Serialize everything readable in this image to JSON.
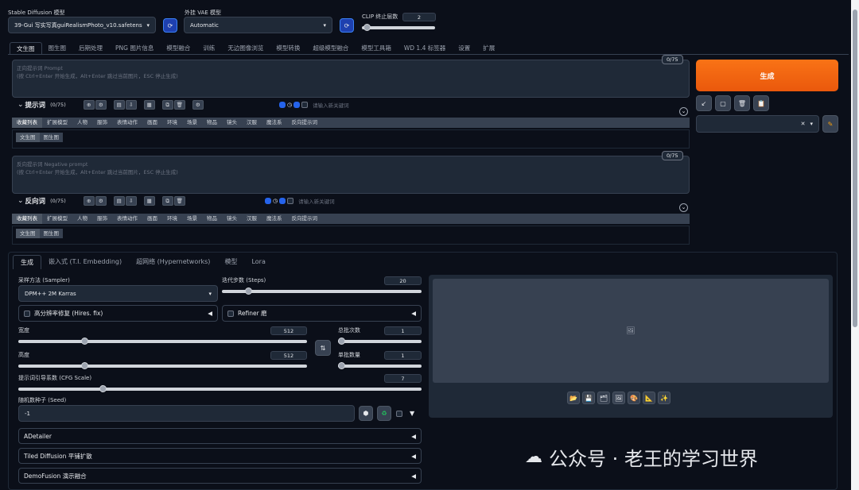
{
  "top": {
    "model_label": "Stable Diffusion 模型",
    "model_value": "39-Gui 写实写真guiRealismPhoto_v10.safetens",
    "vae_label": "外挂 VAE 模型",
    "vae_value": "Automatic",
    "clip_label": "CLIP 终止层数",
    "clip_value": "2"
  },
  "main_tabs": [
    "文生图",
    "图生图",
    "后期处理",
    "PNG 图片信息",
    "模型融合",
    "训练",
    "无边图像浏览",
    "模型转换",
    "超级模型融合",
    "模型工具箱",
    "WD 1.4 标签器",
    "设置",
    "扩展"
  ],
  "prompt": {
    "placeholder_line1": "正向提示词 Prompt",
    "placeholder_line2": "(按 Ctrl+Enter 开始生成，Alt+Enter 跳过当前图片，ESC 停止生成)",
    "counter": "0/75",
    "title": "提示词",
    "count": "(0/75)",
    "keyword_placeholder": "请输入新关键词"
  },
  "categories": [
    "收藏列表",
    "扩展模型",
    "人物",
    "服饰",
    "表情动作",
    "画面",
    "环境",
    "场景",
    "物品",
    "镜头",
    "汉服",
    "魔法系",
    "反向提示词"
  ],
  "sub_tabs": [
    "文生图",
    "图生图"
  ],
  "negative": {
    "placeholder_line1": "反向提示词 Negative prompt",
    "placeholder_line2": "(按 Ctrl+Enter 开始生成，Alt+Enter 跳过当前图片，ESC 停止生成)",
    "counter": "0/75",
    "title": "反向词",
    "count": "(0/75)",
    "keyword_placeholder": "请输入新关键词"
  },
  "generate_label": "生成",
  "gen_tabs": [
    "生成",
    "嵌入式 (T.I. Embedding)",
    "超网络 (Hypernetworks)",
    "模型",
    "Lora"
  ],
  "params": {
    "sampler_label": "采样方法 (Sampler)",
    "sampler_value": "DPM++ 2M Karras",
    "steps_label": "迭代步数 (Steps)",
    "steps_value": "20",
    "steps_fraction": 0.13,
    "hires_label": "高分辨率修复 (Hires. fix)",
    "refiner_label": "Refiner 磨",
    "width_label": "宽度",
    "width_value": "512",
    "width_fraction": 0.23,
    "height_label": "高度",
    "height_value": "512",
    "height_fraction": 0.23,
    "batch_count_label": "总批次数",
    "batch_count_value": "1",
    "batch_size_label": "单批数量",
    "batch_size_value": "1",
    "cfg_label": "提示词引导系数 (CFG Scale)",
    "cfg_value": "7",
    "cfg_fraction": 0.21,
    "seed_label": "随机数种子 (Seed)",
    "seed_value": "-1"
  },
  "accordions": [
    "ADetailer",
    "Tiled Diffusion 平铺扩散",
    "DemoFusion 演示融合"
  ],
  "watermark": "公众号 · 老王的学习世界",
  "colors": {
    "accent": "#f97316",
    "bg": "#0b0f19",
    "panel": "#1f2937"
  }
}
